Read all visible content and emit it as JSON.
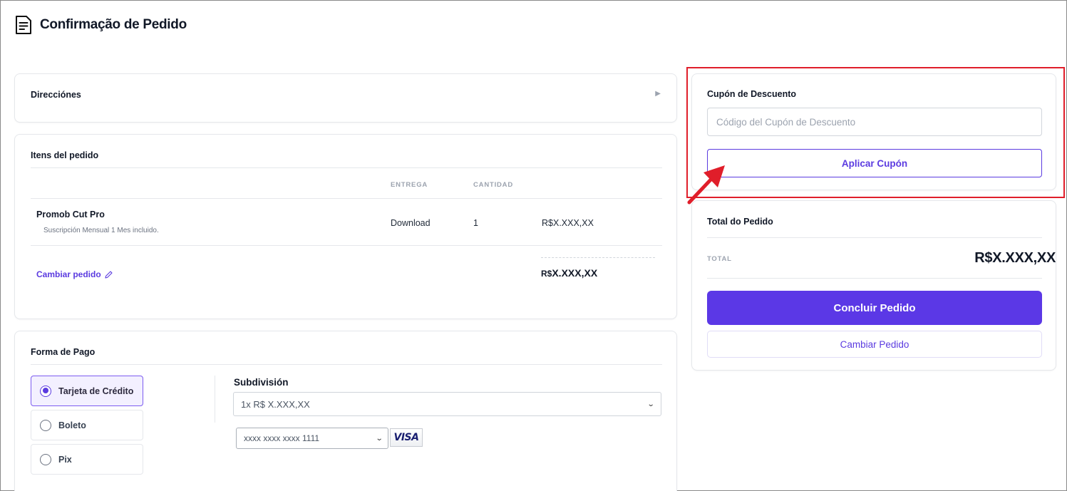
{
  "header": {
    "title": "Confirmação de Pedido",
    "icon": "document-icon"
  },
  "addresses": {
    "title": "Direcciónes",
    "expand_icon": "caret-right-icon"
  },
  "order_items": {
    "title": "Itens del pedido",
    "columns": {
      "delivery": "ENTREGA",
      "quantity": "CANTIDAD"
    },
    "rows": [
      {
        "name": "Promob Cut Pro",
        "description": "Suscripción Mensual 1 Mes incluido.",
        "delivery": "Download",
        "quantity": "1",
        "price": "R$X.XXX,XX"
      }
    ],
    "change_link": "Cambiar pedido",
    "subtotal_currency": "R$",
    "subtotal_value": "X.XXX,XX"
  },
  "payment": {
    "title": "Forma de Pago",
    "options": [
      {
        "label": "Tarjeta de Crédito",
        "selected": true
      },
      {
        "label": "Boleto",
        "selected": false
      },
      {
        "label": "Pix",
        "selected": false
      }
    ],
    "subdivision_label": "Subdivisión",
    "installment_selected": "1x R$ X.XXX,XX",
    "card_selected": "xxxx xxxx xxxx 1111",
    "card_brand": "VISA"
  },
  "coupon": {
    "title": "Cupón de Descuento",
    "placeholder": "Código del Cupón de Descuento",
    "value": "",
    "apply_label": "Aplicar Cupón"
  },
  "summary": {
    "title": "Total do Pedido",
    "total_label": "TOTAL",
    "total_value": "R$X.XXX,XX",
    "conclude_label": "Concluir Pedido",
    "change_label": "Cambiar Pedido"
  },
  "colors": {
    "accent": "#5b38e6",
    "highlight": "#e01e2a"
  }
}
